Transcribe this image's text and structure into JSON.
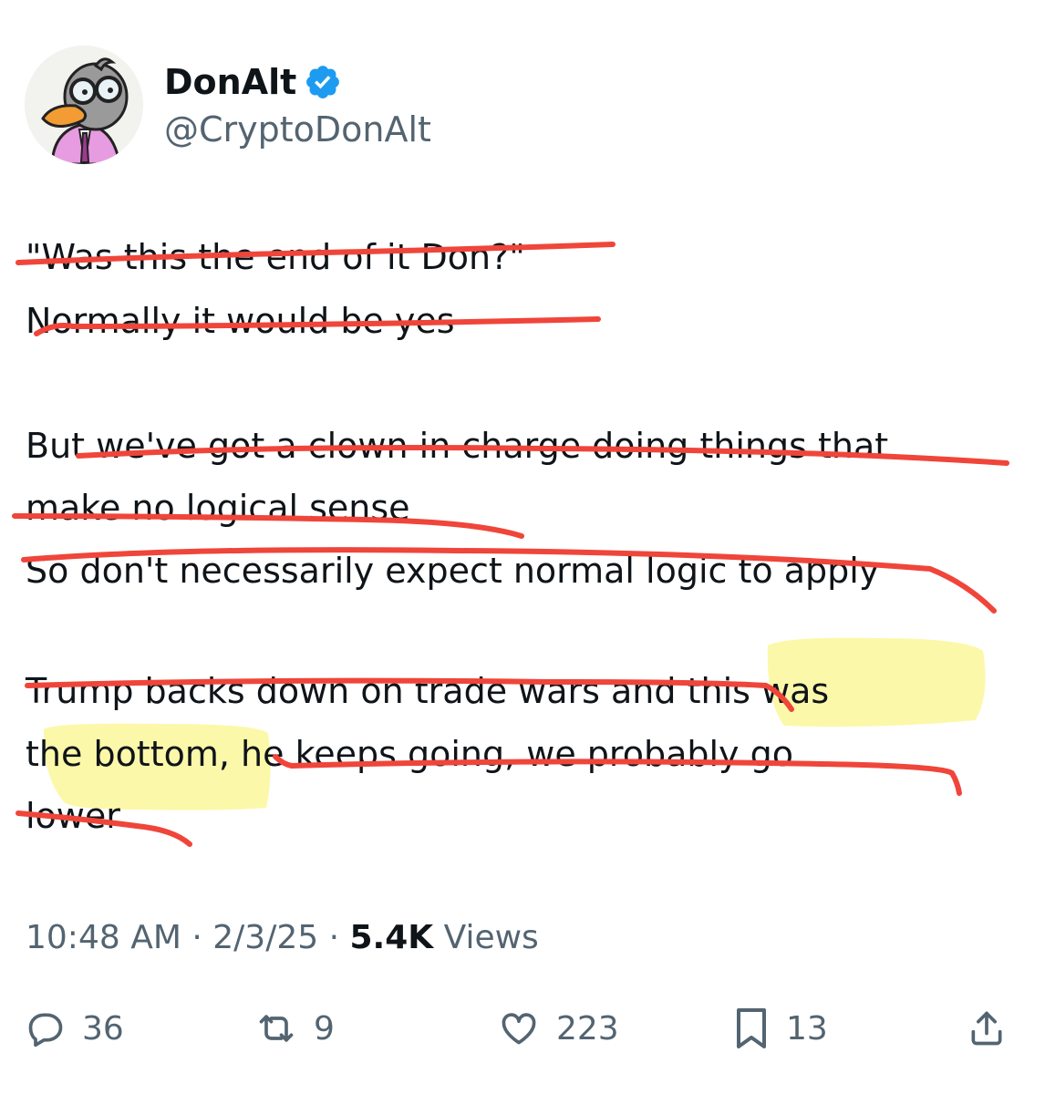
{
  "author": {
    "name": "DonAlt",
    "handle": "@CryptoDonAlt",
    "verified": true,
    "avatar_icon": "duck-with-glasses-avatar"
  },
  "tweet": {
    "lines": [
      "\"Was this the end of it Don?\"",
      "Normally it would be yes",
      "But we've got a clown in charge doing things that",
      "make no logical sense",
      "So don't necessarily expect normal logic to apply",
      "Trump backs down on trade wars and this was",
      "the bottom, he keeps going, we probably go",
      "lower"
    ]
  },
  "annotations": {
    "strike_color": "#f0453a",
    "highlight_color": "#fbf79a"
  },
  "meta": {
    "time": "10:48 AM",
    "date": "2/3/25",
    "views_count": "5.4K",
    "views_label": "Views",
    "separator": "·"
  },
  "actions": {
    "replies": "36",
    "reposts": "9",
    "likes": "223",
    "bookmarks": "13"
  },
  "colors": {
    "text": "#0f1419",
    "secondary": "#536471",
    "verified_badge": "#1d9bf0"
  }
}
